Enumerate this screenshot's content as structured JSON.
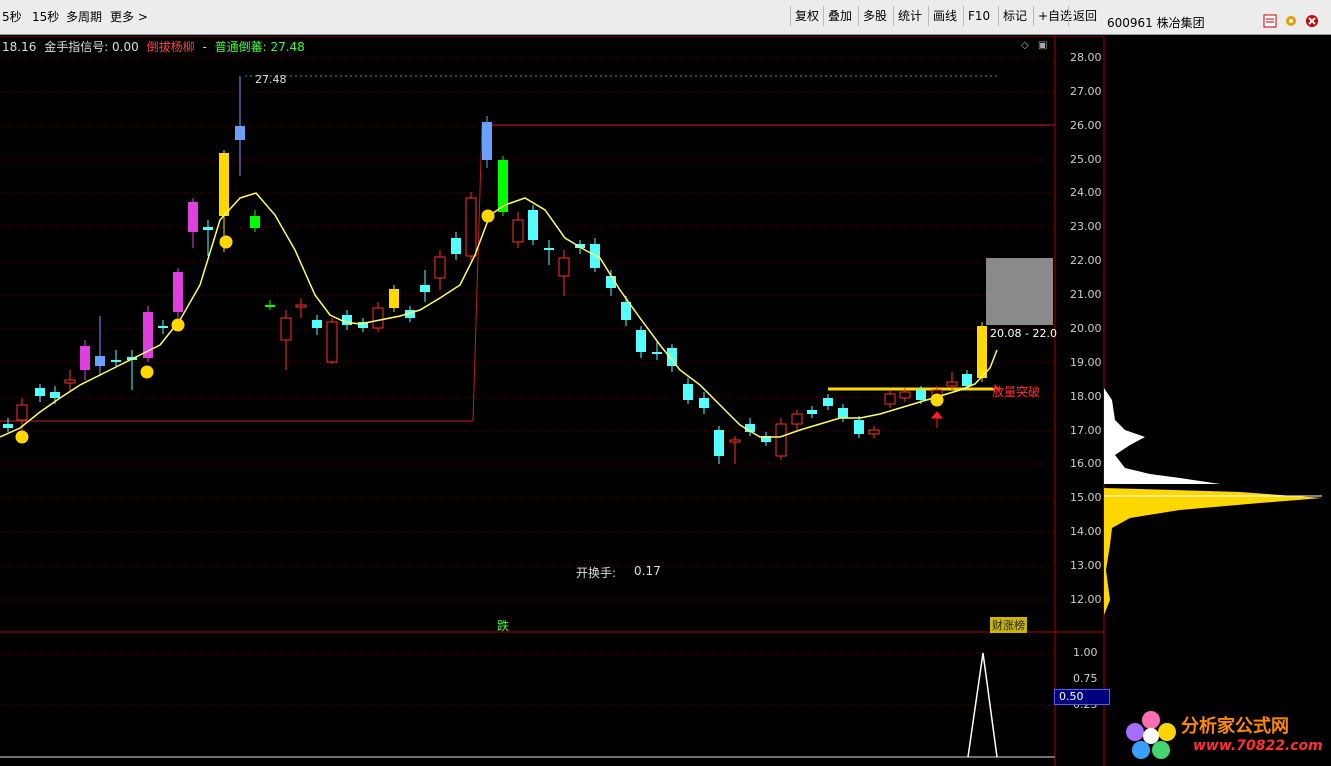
{
  "toolbar": {
    "left": [
      "5秒",
      "15秒",
      "多周期",
      "更多 >"
    ],
    "right": [
      "复权",
      "叠加",
      "多股",
      "统计",
      "画线",
      "F10",
      "标记",
      "+自选",
      "返回"
    ]
  },
  "stock": {
    "code_name": "600961 株冶集团"
  },
  "info": {
    "value": "18.16",
    "signal_label": "金手指信号: 0.00",
    "pattern_name": "倒拔杨柳",
    "separator": "-",
    "normal_label": "普通倒蕃: 27.48"
  },
  "price_axis": [
    "28.00",
    "27.00",
    "26.00",
    "25.00",
    "24.00",
    "23.00",
    "22.00",
    "21.00",
    "20.00",
    "19.00",
    "18.00",
    "17.00",
    "16.00",
    "15.00",
    "14.00",
    "13.00",
    "12.00"
  ],
  "indicator_axis": [
    "1.00",
    "0.75",
    "0.50",
    "0.25"
  ],
  "indicator_current": "0.50",
  "annotations": {
    "high_label": "27.48",
    "range_label": "20.08 - 22.0",
    "breakout_label": "放量突破",
    "turnover_label": "开换手:",
    "turnover_value": "0.17",
    "fall_label": "跌",
    "caizhang_label": "财涨榜"
  },
  "watermark": "分析家公式网www.70822.com",
  "logo": {
    "text": "分析家公式网",
    "url": "www.70822.com"
  },
  "colors": {
    "up": "#ff3030",
    "down": "#54ffff",
    "ma": "#ffff66",
    "grid": "#5a0000",
    "axis": "#b00000",
    "accent": "#ffd800",
    "green": "#00ff00",
    "magenta": "#e03fe0"
  }
}
